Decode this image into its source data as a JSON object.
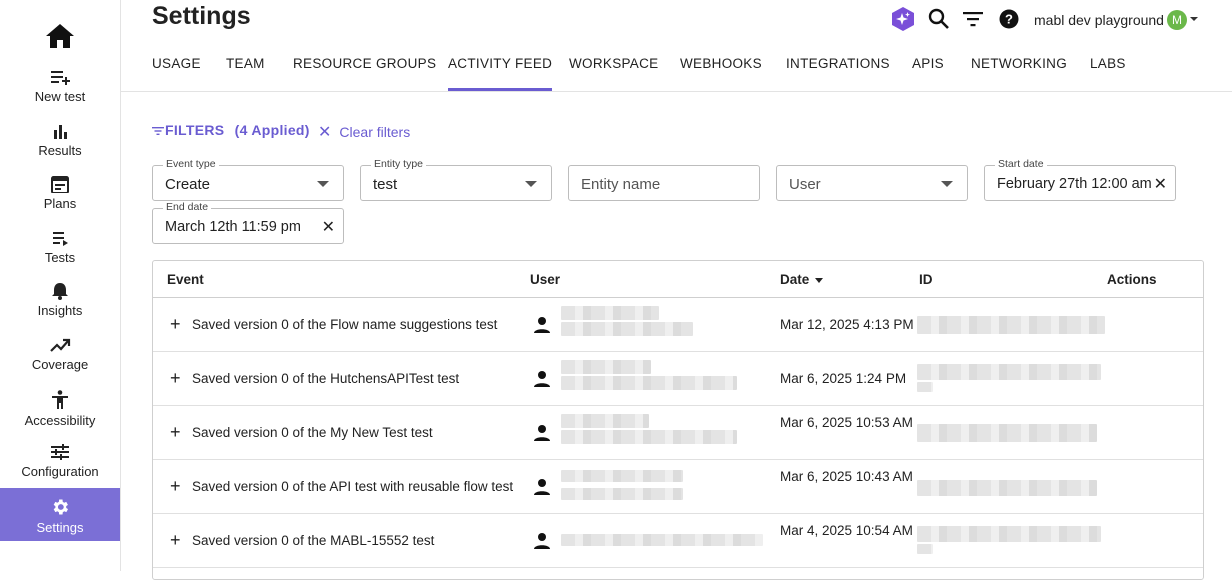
{
  "sidebar": {
    "items": [
      {
        "label": "New test",
        "icon": "new-test-icon"
      },
      {
        "label": "Results",
        "icon": "bar-chart-icon"
      },
      {
        "label": "Plans",
        "icon": "calendar-icon"
      },
      {
        "label": "Tests",
        "icon": "list-play-icon"
      },
      {
        "label": "Insights",
        "icon": "bell-icon"
      },
      {
        "label": "Coverage",
        "icon": "trending-up-icon"
      },
      {
        "label": "Accessibility",
        "icon": "accessibility-icon"
      },
      {
        "label": "Configuration",
        "icon": "sliders-icon"
      },
      {
        "label": "Settings",
        "icon": "gear-icon"
      }
    ]
  },
  "header": {
    "title": "Settings",
    "workspace": "mabl dev playground",
    "avatar_initial": "M"
  },
  "tabs": [
    "USAGE",
    "TEAM",
    "RESOURCE GROUPS",
    "ACTIVITY FEED",
    "WORKSPACE",
    "WEBHOOKS",
    "INTEGRATIONS",
    "APIS",
    "NETWORKING",
    "LABS"
  ],
  "filters": {
    "label": "FILTERS",
    "applied": "(4 Applied)",
    "clear": "Clear filters",
    "event_type": {
      "label": "Event type",
      "value": "Create"
    },
    "entity_type": {
      "label": "Entity type",
      "value": "test"
    },
    "entity_name": {
      "placeholder": "Entity name"
    },
    "user": {
      "placeholder": "User"
    },
    "start_date": {
      "label": "Start date",
      "value": "February 27th 12:00 am"
    },
    "end_date": {
      "label": "End date",
      "value": "March 12th 11:59 pm"
    }
  },
  "table": {
    "headers": {
      "event": "Event",
      "user": "User",
      "date": "Date",
      "id": "ID",
      "actions": "Actions"
    },
    "rows": [
      {
        "event": "Saved version 0 of the Flow name suggestions test",
        "date": "Mar 12, 2025 4:13 PM"
      },
      {
        "event": "Saved version 0 of the HutchensAPITest test",
        "date": "Mar 6, 2025 1:24 PM"
      },
      {
        "event": "Saved version 0 of the My New Test test",
        "date": "Mar 6, 2025 10:53 AM"
      },
      {
        "event": "Saved version 0 of the API test with reusable flow test",
        "date": "Mar 6, 2025 10:43 AM"
      },
      {
        "event": "Saved version 0 of the MABL-15552 test",
        "date": "Mar 4, 2025 10:54 AM"
      }
    ]
  },
  "colors": {
    "accent": "#6a5cd1",
    "sidebar_active": "#7b6fd6",
    "avatar": "#6bb84a"
  }
}
